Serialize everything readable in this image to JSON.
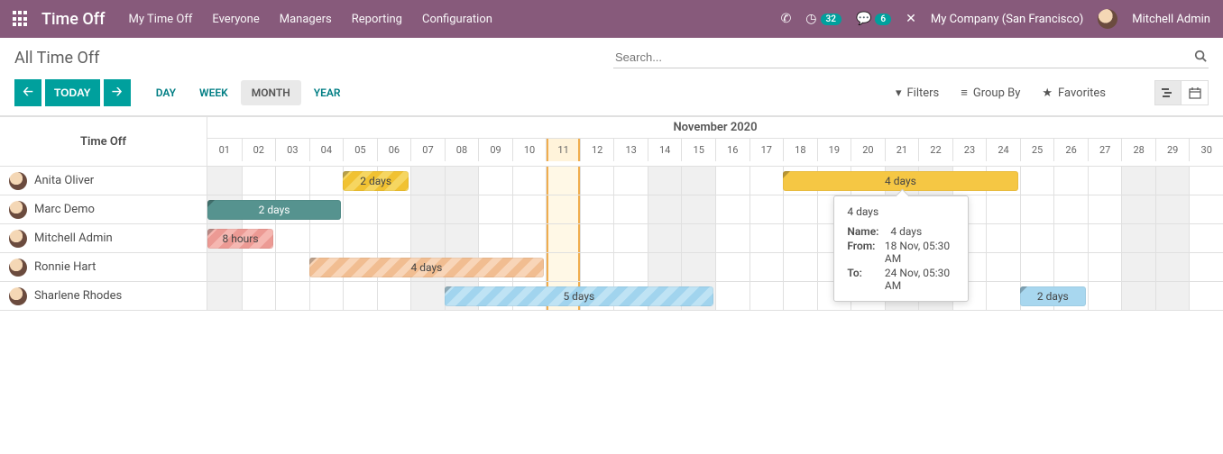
{
  "brand": "Time Off",
  "nav_menu": [
    "My Time Off",
    "Everyone",
    "Managers",
    "Reporting",
    "Configuration"
  ],
  "badges": {
    "clock": "32",
    "chat": "6"
  },
  "company": "My Company (San Francisco)",
  "user_name": "Mitchell Admin",
  "breadcrumb": "All Time Off",
  "search": {
    "placeholder": "Search..."
  },
  "today_btn": "TODAY",
  "scales": {
    "day": "DAY",
    "week": "WEEK",
    "month": "MONTH",
    "year": "YEAR"
  },
  "search_opts": {
    "filters": "Filters",
    "groupby": "Group By",
    "favorites": "Favorites"
  },
  "row_header": "Time Off",
  "period_title": "November 2020",
  "days": [
    "01",
    "02",
    "03",
    "04",
    "05",
    "06",
    "07",
    "08",
    "09",
    "10",
    "11",
    "12",
    "13",
    "14",
    "15",
    "16",
    "17",
    "18",
    "19",
    "20",
    "21",
    "22",
    "23",
    "24",
    "25",
    "26",
    "27",
    "28",
    "29",
    "30"
  ],
  "today_index": 10,
  "weekend_idx": [
    0,
    6,
    7,
    13,
    14,
    20,
    21,
    27,
    28
  ],
  "employees": [
    "Anita Oliver",
    "Marc Demo",
    "Mitchell Admin",
    "Ronnie Hart",
    "Sharlene Rhodes"
  ],
  "pills": {
    "anita1": "2 days",
    "anita2": "4 days",
    "marc": "2 days",
    "mitch": "8 hours",
    "ronnie": "4 days",
    "shar1": "5 days",
    "shar2": "2 days"
  },
  "tooltip": {
    "title": "4 days",
    "name_label": "Name:",
    "name_val": "4 days",
    "from_label": "From:",
    "from_val": "18 Nov, 05:30 AM",
    "to_label": "To:",
    "to_val": "24 Nov, 05:30 AM"
  }
}
